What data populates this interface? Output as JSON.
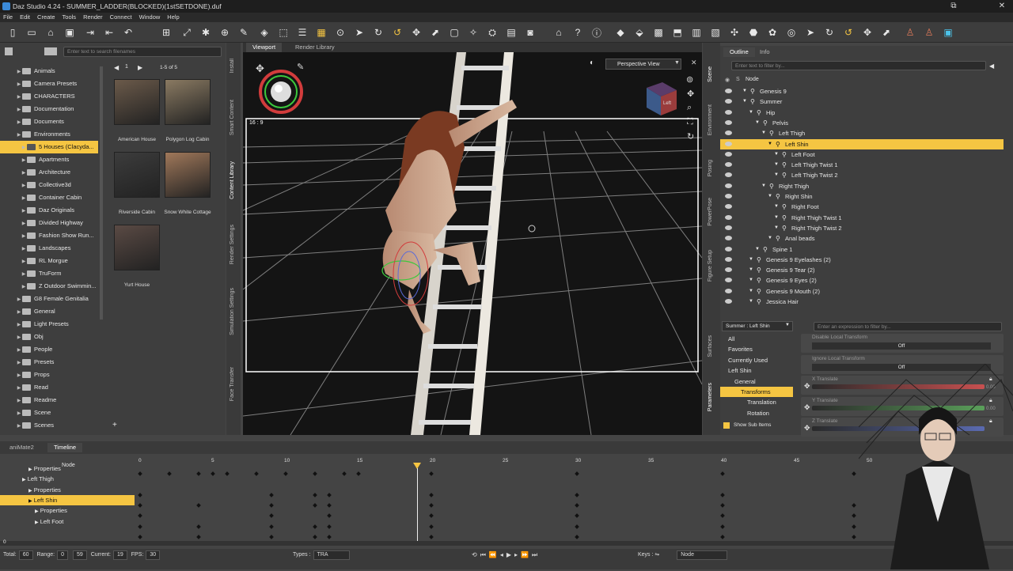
{
  "window": {
    "title": "Daz Studio 4.24 - SUMMER_LADDER(BLOCKED)(1stSETDONE).duf",
    "controls": [
      "⧉",
      "✕"
    ]
  },
  "menu": [
    "File",
    "Edit",
    "Create",
    "Tools",
    "Render",
    "Connect",
    "Window",
    "Help"
  ],
  "content_library": {
    "search_placeholder": "Enter text to search filenames",
    "page_number": "1",
    "page_range": "1-5 of 5",
    "add_label": "+",
    "tree": [
      {
        "label": "Animals",
        "depth": 1
      },
      {
        "label": "Camera Presets",
        "depth": 1
      },
      {
        "label": "CHARACTERS",
        "depth": 1
      },
      {
        "label": "Documentation",
        "depth": 1
      },
      {
        "label": "Documents",
        "depth": 1
      },
      {
        "label": "Environments",
        "depth": 1
      },
      {
        "label": "5 Houses (Clacyda...",
        "depth": 2,
        "selected": true
      },
      {
        "label": "Apartments",
        "depth": 2
      },
      {
        "label": "Architecture",
        "depth": 2
      },
      {
        "label": "Collective3d",
        "depth": 2
      },
      {
        "label": "Container Cabin",
        "depth": 2
      },
      {
        "label": "Daz Originals",
        "depth": 2
      },
      {
        "label": "Divided Highway",
        "depth": 2
      },
      {
        "label": "Fashion Show Run...",
        "depth": 2
      },
      {
        "label": "Landscapes",
        "depth": 2
      },
      {
        "label": "RL Morgue",
        "depth": 2
      },
      {
        "label": "TruForm",
        "depth": 2
      },
      {
        "label": "Z Outdoor Swimmin...",
        "depth": 2
      },
      {
        "label": "G8 Female Genitalia",
        "depth": 1
      },
      {
        "label": "General",
        "depth": 1
      },
      {
        "label": "Light Presets",
        "depth": 1
      },
      {
        "label": "Obj",
        "depth": 1
      },
      {
        "label": "People",
        "depth": 1
      },
      {
        "label": "Presets",
        "depth": 1
      },
      {
        "label": "Props",
        "depth": 1
      },
      {
        "label": "Read",
        "depth": 1
      },
      {
        "label": "Readme",
        "depth": 1
      },
      {
        "label": "Scene",
        "depth": 1
      },
      {
        "label": "Scenes",
        "depth": 1
      }
    ],
    "thumbnails": [
      {
        "label": "American House",
        "color": "#6b5a4a"
      },
      {
        "label": "Polygon Log Cabin",
        "color": "#8a7a62"
      },
      {
        "label": "Riverside Cabin",
        "color": "#3c3c3c"
      },
      {
        "label": "Snow White Cottage",
        "color": "#a0785a"
      },
      {
        "label": "Yurt House",
        "color": "#5a4a44"
      }
    ]
  },
  "side_tabs_left": [
    "Install",
    "Smart Content",
    "Content Library",
    "Render Settings",
    "Simulation Settings",
    "Face Transfer"
  ],
  "viewport": {
    "tabs": [
      "Viewport",
      "Render Library"
    ],
    "view_mode": "Perspective View",
    "aspect": "16 : 9",
    "cube_label": "Left"
  },
  "scene": {
    "tabs": [
      "Outline",
      "Info"
    ],
    "filter_placeholder": "Enter text to filter by...",
    "column": "Node",
    "nodes": [
      {
        "label": "Genesis 9",
        "depth": 0
      },
      {
        "label": "Summer",
        "depth": 0
      },
      {
        "label": "Hip",
        "depth": 1
      },
      {
        "label": "Pelvis",
        "depth": 2
      },
      {
        "label": "Left Thigh",
        "depth": 3
      },
      {
        "label": "Left Shin",
        "depth": 4,
        "selected": true
      },
      {
        "label": "Left Foot",
        "depth": 5
      },
      {
        "label": "Left Thigh Twist 1",
        "depth": 5
      },
      {
        "label": "Left Thigh Twist 2",
        "depth": 5
      },
      {
        "label": "Right Thigh",
        "depth": 3
      },
      {
        "label": "Right Shin",
        "depth": 4
      },
      {
        "label": "Right Foot",
        "depth": 5
      },
      {
        "label": "Right Thigh Twist 1",
        "depth": 5
      },
      {
        "label": "Right Thigh Twist 2",
        "depth": 5
      },
      {
        "label": "Anal beads",
        "depth": 4
      },
      {
        "label": "Spine 1",
        "depth": 2
      },
      {
        "label": "Genesis 9 Eyelashes (2)",
        "depth": 1
      },
      {
        "label": "Genesis 9 Tear (2)",
        "depth": 1
      },
      {
        "label": "Genesis 9 Eyes (2)",
        "depth": 1
      },
      {
        "label": "Genesis 9 Mouth (2)",
        "depth": 1
      },
      {
        "label": "Jessica Hair",
        "depth": 1
      }
    ]
  },
  "side_tabs_right": [
    "Scene",
    "Environment",
    "Posing",
    "PowerPose",
    "Figure Setup",
    "Surfaces",
    "Parameters"
  ],
  "parameters": {
    "node_select": "Summer : Left Shin",
    "filter_placeholder": "Enter an expression to filter by...",
    "groups": [
      {
        "label": "All",
        "depth": 0
      },
      {
        "label": "Favorites",
        "depth": 0
      },
      {
        "label": "Currently Used",
        "depth": 0
      },
      {
        "label": "Left Shin",
        "depth": 0
      },
      {
        "label": "General",
        "depth": 1
      },
      {
        "label": "Transforms",
        "depth": 2,
        "selected": true
      },
      {
        "label": "Translation",
        "depth": 3
      },
      {
        "label": "Rotation",
        "depth": 3
      }
    ],
    "show_sub_items": "Show Sub Items",
    "props": [
      {
        "label": "Disable Local Transform",
        "value": "Off"
      },
      {
        "label": "Ignore Local Transform",
        "value": "Off"
      },
      {
        "label": "X Translate",
        "value": "0.00",
        "color": "#c85050"
      },
      {
        "label": "Y Translate",
        "value": "0.00",
        "color": "#5aa05a"
      },
      {
        "label": "Z Translate",
        "value": "",
        "color": "#5a6ab0"
      }
    ]
  },
  "timeline": {
    "tabs": [
      "aniMate2",
      "Timeline"
    ],
    "col_header": "Node",
    "rows": [
      {
        "label": "Properties",
        "depth": 1
      },
      {
        "label": "Left Thigh",
        "depth": 0
      },
      {
        "label": "Properties",
        "depth": 1
      },
      {
        "label": "Left Shin",
        "depth": 1,
        "selected": true
      },
      {
        "label": "Properties",
        "depth": 2
      },
      {
        "label": "Left Foot",
        "depth": 2
      }
    ],
    "ticks": [
      "0",
      "5",
      "10",
      "15",
      "20",
      "25",
      "30",
      "35",
      "40",
      "45",
      "50"
    ],
    "current_marker": 19,
    "scroll_value": "0"
  },
  "status": {
    "total_label": "Total:",
    "total": "60",
    "range_label": "Range:",
    "range_start": "0",
    "range_end": "59",
    "current_label": "Current:",
    "current": "19",
    "fps_label": "FPS:",
    "fps": "30",
    "types_label": "Types :",
    "types": "TRA",
    "keys_label": "Keys :",
    "node_mode": "Node"
  },
  "colors": {
    "accent": "#f5c542",
    "panel": "#3e3e3e",
    "dark": "#1e1e1e"
  }
}
